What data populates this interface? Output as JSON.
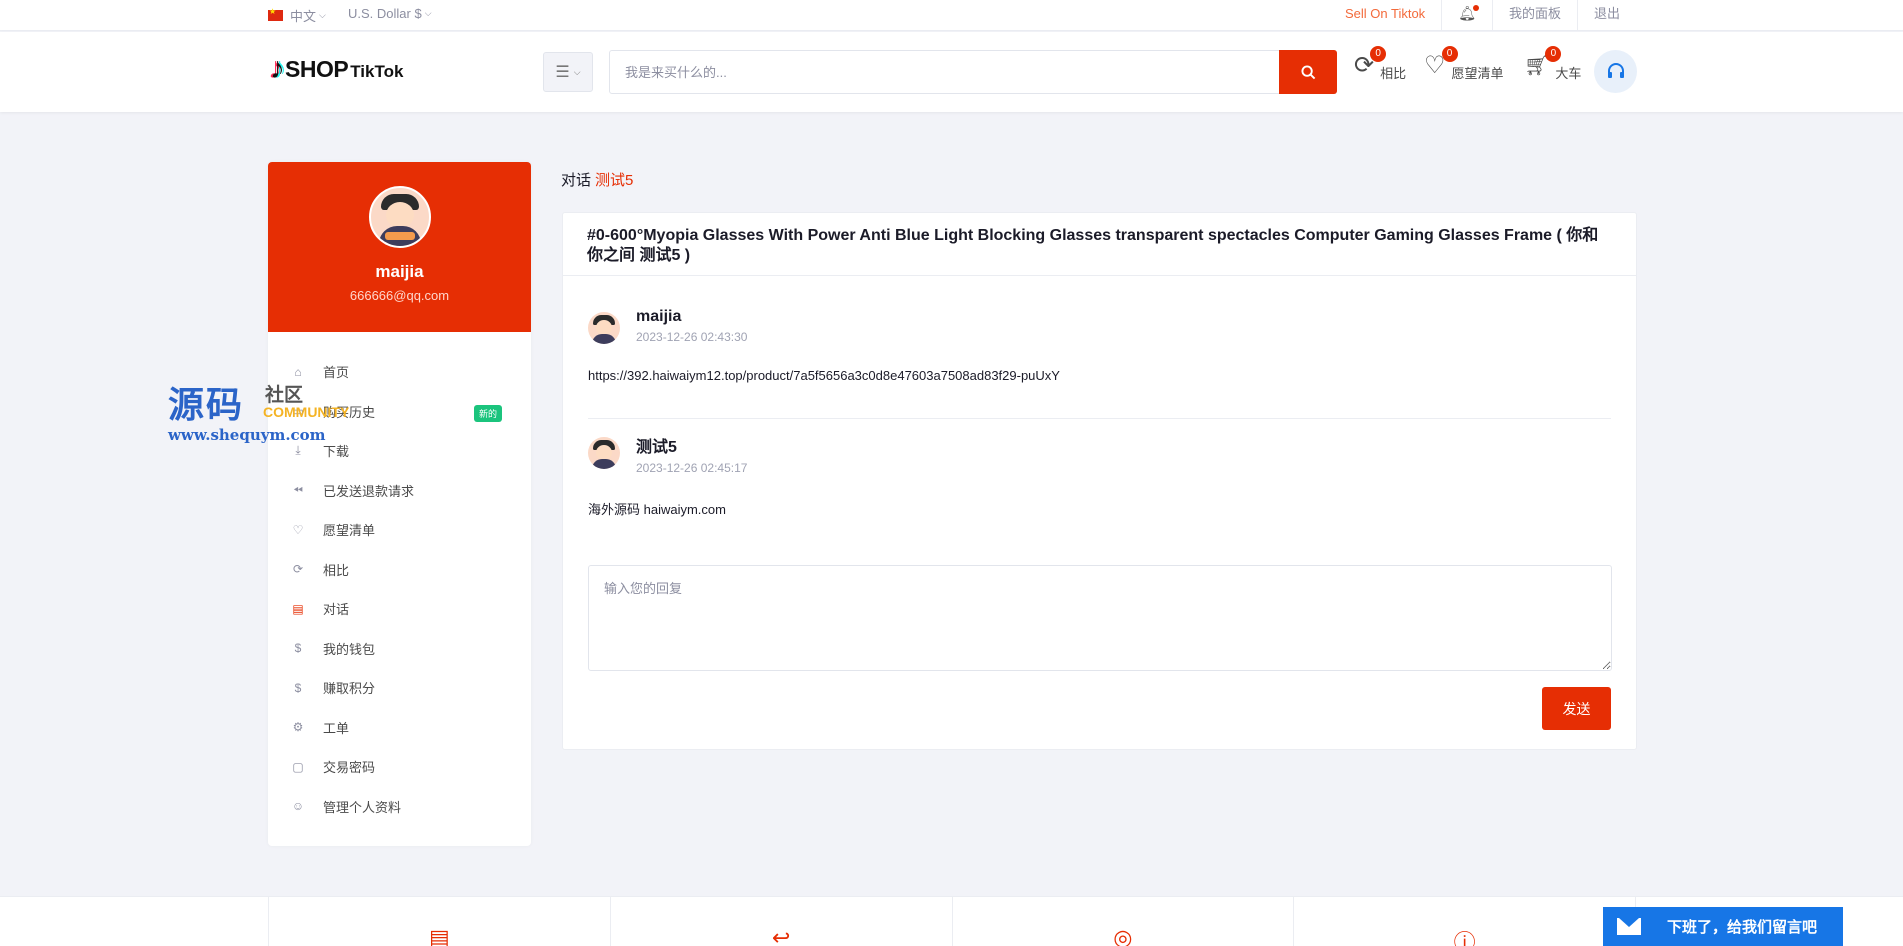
{
  "topbar": {
    "language": "中文",
    "currency": "U.S. Dollar $",
    "sell_link": "Sell On Tiktok",
    "dashboard": "我的面板",
    "logout": "退出"
  },
  "header": {
    "logo_shop": "SHOP",
    "logo_tiktok": "TikTok",
    "search_placeholder": "我是来买什么的...",
    "compare": {
      "label": "相比",
      "count": "0"
    },
    "wishlist": {
      "label": "愿望清单",
      "count": "0"
    },
    "cart": {
      "label": "大车",
      "count": "0"
    }
  },
  "profile": {
    "name": "maijia",
    "email": "666666@qq.com"
  },
  "sidebar": {
    "items": [
      {
        "label": "首页",
        "icon": "home-icon"
      },
      {
        "label": "购买历史",
        "icon": "file-icon",
        "badge": "新的"
      },
      {
        "label": "下载",
        "icon": "download-icon"
      },
      {
        "label": "已发送退款请求",
        "icon": "refund-icon"
      },
      {
        "label": "愿望清单",
        "icon": "heart-icon"
      },
      {
        "label": "相比",
        "icon": "refresh-icon"
      },
      {
        "label": "对话",
        "icon": "chat-icon"
      },
      {
        "label": "我的钱包",
        "icon": "dollar-icon"
      },
      {
        "label": "赚取积分",
        "icon": "dollar-icon"
      },
      {
        "label": "工单",
        "icon": "gear-icon"
      },
      {
        "label": "交易密码",
        "icon": "wallet-icon"
      },
      {
        "label": "管理个人资料",
        "icon": "user-icon"
      }
    ]
  },
  "watermark": {
    "big": "源码",
    "small": "社区",
    "community": "COMMUNITY",
    "url": "www.shequym.com"
  },
  "breadcrumb": {
    "label": "对话",
    "current": "测试5"
  },
  "conversation": {
    "title": "#0-600°Myopia Glasses With Power Anti Blue Light Blocking Glasses transparent spectacles Computer Gaming Glasses Frame ( 你和你之间 测试5 )",
    "messages": [
      {
        "user": "maijia",
        "time": "2023-12-26 02:43:30",
        "text": "https://392.haiwaiym12.top/product/7a5f5656a3c0d8e47603a7508ad83f29-puUxY"
      },
      {
        "user": "测试5",
        "time": "2023-12-26 02:45:17",
        "text": "海外源码 haiwaiym.com"
      }
    ],
    "reply_placeholder": "输入您的回复",
    "send_label": "发送"
  },
  "chat_widget": {
    "label": "下班了，给我们留言吧"
  },
  "colors": {
    "accent": "#e62e04",
    "background": "#f2f3f8",
    "chat": "#1776e6"
  }
}
